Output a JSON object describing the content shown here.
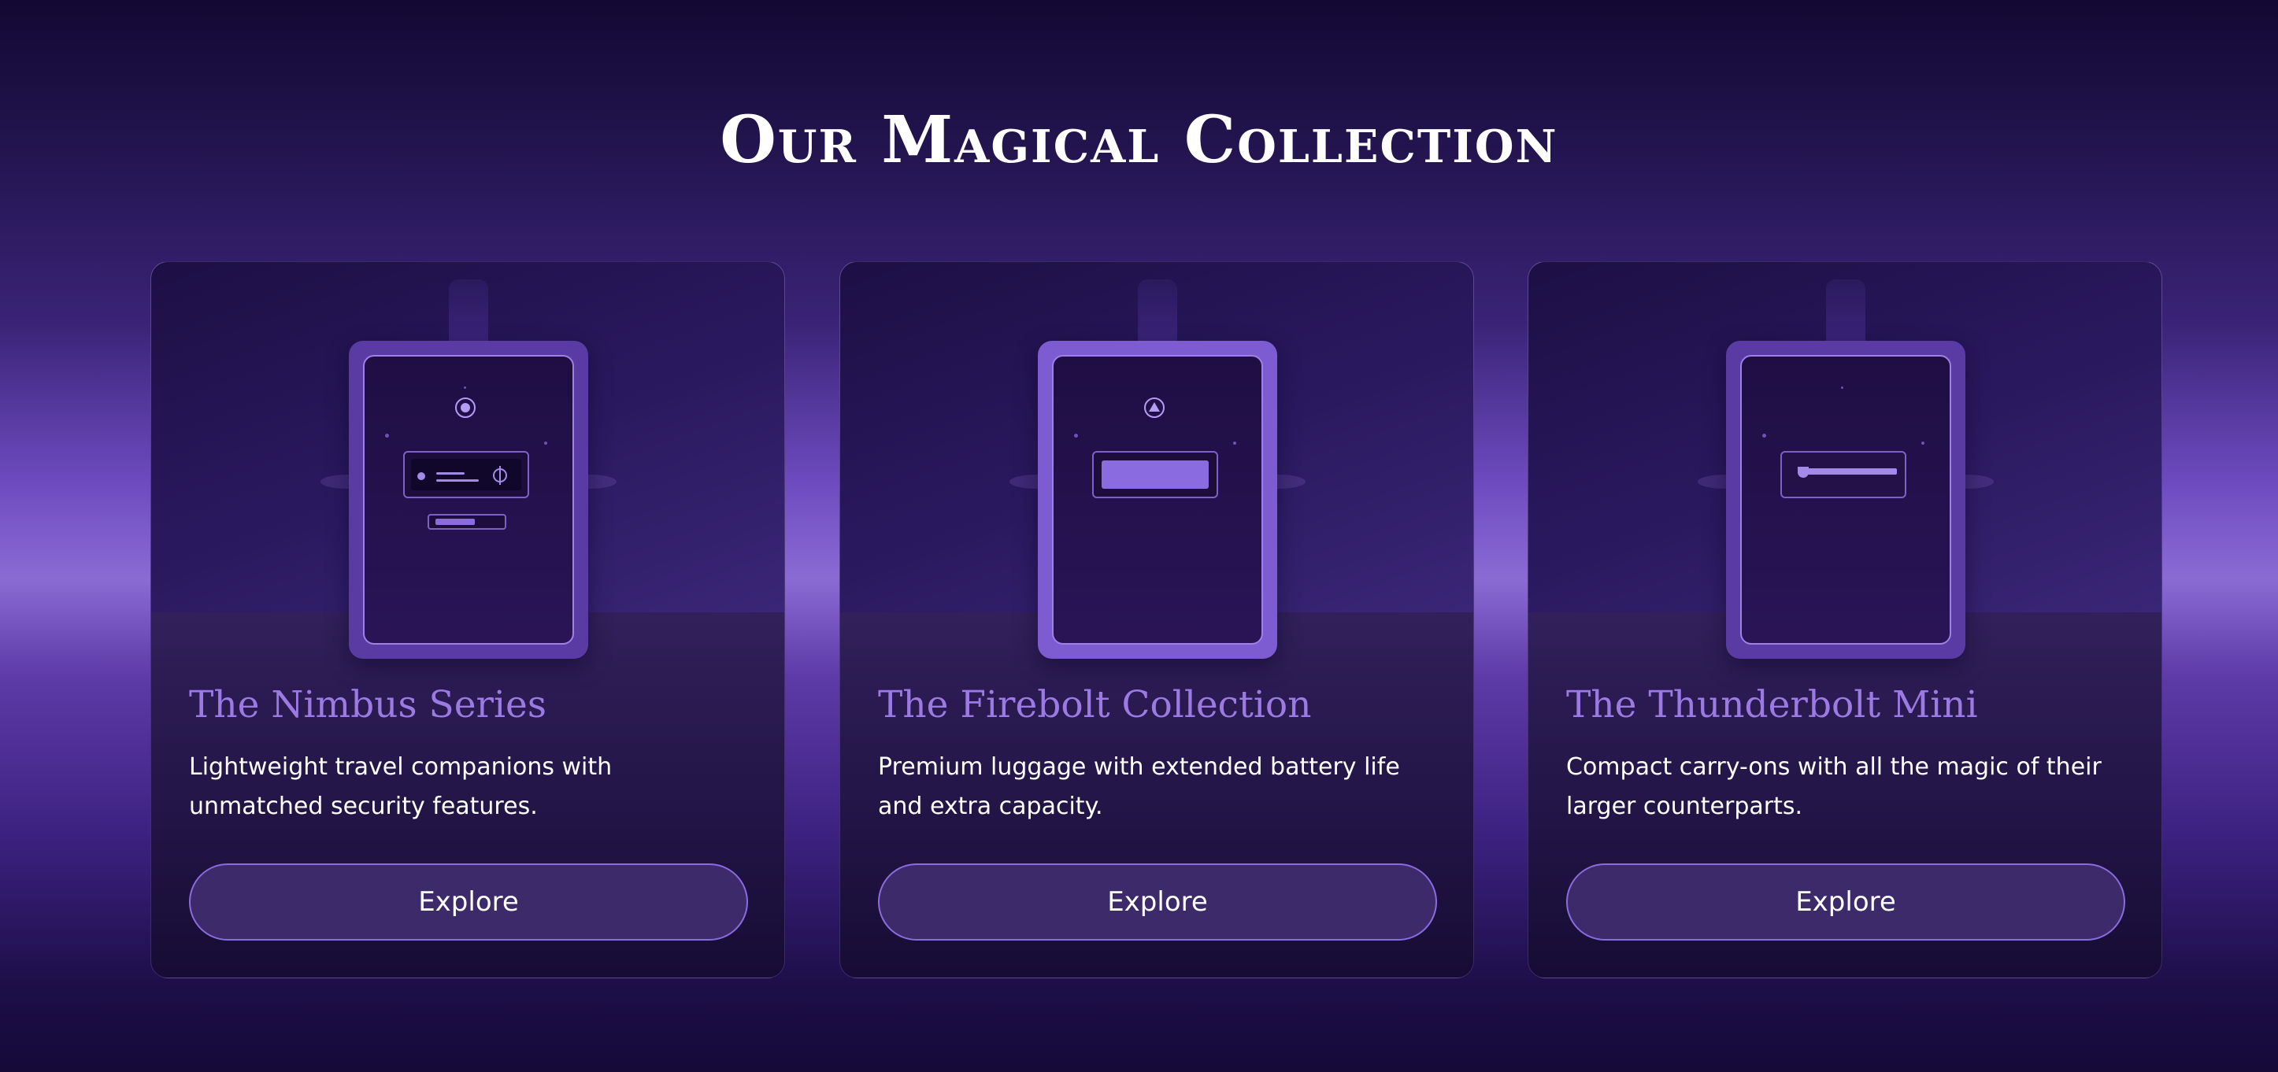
{
  "page": {
    "title": "Our Magical Collection"
  },
  "colors": {
    "accent": "#9b7ae3",
    "button_background": "#3d2a6a",
    "button_border": "#8b6be0"
  },
  "products": [
    {
      "title": "The Nimbus Series",
      "description": "Lightweight travel companions with unmatched security features.",
      "button_label": "Explore",
      "emblem": "circle-emblem-icon"
    },
    {
      "title": "The Firebolt Collection",
      "description": "Premium luggage with extended battery life and extra capacity.",
      "button_label": "Explore",
      "emblem": "triangle-emblem-icon"
    },
    {
      "title": "The Thunderbolt Mini",
      "description": "Compact carry-ons with all the magic of their larger counterparts.",
      "button_label": "Explore",
      "emblem": "slot-icon"
    }
  ]
}
